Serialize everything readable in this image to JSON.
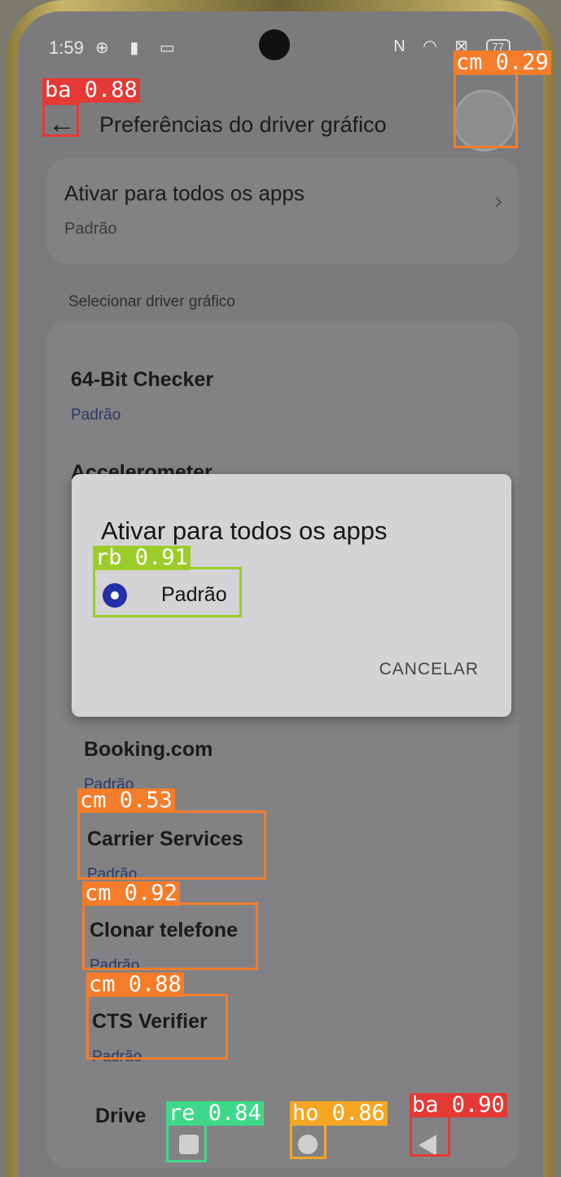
{
  "status_bar": {
    "time": "1:59",
    "left_icons": "⊕ ▮ ▭",
    "right_icons": "N ◠ ⊠",
    "battery": "77"
  },
  "app_bar": {
    "title": "Preferências do driver gráfico"
  },
  "all_apps_card": {
    "title": "Ativar para todos os apps",
    "value": "Padrão"
  },
  "section_label": "Selecionar driver gráfico",
  "apps": [
    {
      "name": "64-Bit Checker",
      "value": "Padrão"
    },
    {
      "name": "Accelerometer",
      "value": ""
    },
    {
      "name": "Booking.com",
      "value": "Padrão"
    },
    {
      "name": "Carrier Services",
      "value": "Padrão"
    },
    {
      "name": "Clonar telefone",
      "value": "Padrão"
    },
    {
      "name": "CTS Verifier",
      "value": "Padrão"
    },
    {
      "name": "Drive",
      "value": ""
    }
  ],
  "dialog": {
    "title": "Ativar para todos os apps",
    "option": "Padrão",
    "cancel": "CANCELAR"
  },
  "detections": [
    {
      "label": "ba 0.88",
      "color": "#e53935"
    },
    {
      "label": "cm 0.29",
      "color": "#f57c2a"
    },
    {
      "label": "rb 0.91",
      "color": "#9ccc2a"
    },
    {
      "label": "cm 0.53",
      "color": "#f57c2a"
    },
    {
      "label": "cm 0.92",
      "color": "#f57c2a"
    },
    {
      "label": "cm 0.88",
      "color": "#f57c2a"
    },
    {
      "label": "re 0.84",
      "color": "#3fd88a"
    },
    {
      "label": "ho 0.86",
      "color": "#f5a623"
    },
    {
      "label": "ba 0.90",
      "color": "#e53935"
    }
  ]
}
